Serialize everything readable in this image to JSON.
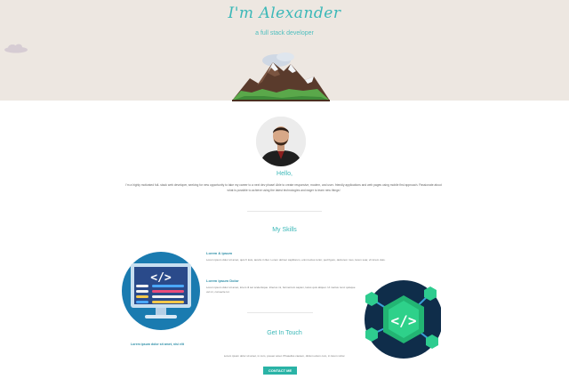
{
  "hero": {
    "title": "I'm Alexander",
    "subtitle": "a full stack developer"
  },
  "about": {
    "heading": "Hello,",
    "text": "I'm a highly motivated full- stack web developer, seeking for new opportunity to take my career to a next dev phase! Able to create responsive, modern, and user- friendly applications and web pages using mobile first approach. Passionate about what is possible to achieve using the latest technologies and eager to learn new things!"
  },
  "skills": {
    "heading": "My Skills",
    "blocks": [
      {
        "title": "Lorem & ipsum",
        "text": "Lorem ipsum dolor sit amet, quis fr kuis, iaculis in liter. Lorem dolmer capillorum, enim lectus tortor, ped figuro, delcurem mus, lorem suar, vit lorem duis."
      },
      {
        "title": "Lorem ipsum Dolor",
        "text": "Lorem ipsum dolor sit amet, lorem ili set scelerisque. Ictecos mi, fermentum sapien, lacus quis aliquet. Ut metius nunc quisque vel mi, consecte tur."
      }
    ]
  },
  "contact": {
    "heading": "Get In Touch",
    "subheading": "Lorem ipsum dolor sit amet, nisi elit",
    "text": "Lorem ipsum dolor sit amet, in cum, posuer amet. Phasellus cautem, dictum etium cum, in lorem victor.",
    "button_label": "CONTACT ME"
  },
  "colors": {
    "accent": "#3bb8b8",
    "hero_bg": "#ede7e1",
    "button": "#2ab3a6"
  }
}
